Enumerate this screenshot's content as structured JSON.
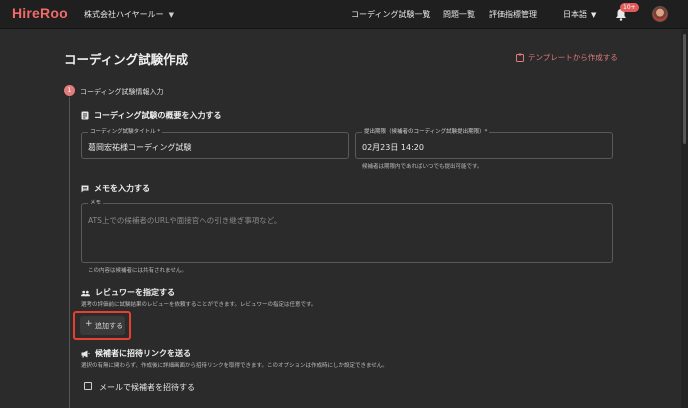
{
  "header": {
    "logo": "HireRoo",
    "company": "株式会社ハイヤールー",
    "nav": [
      "コーディング試験一覧",
      "問題一覧",
      "評価指標管理"
    ],
    "language": "日本語",
    "notification_badge": "10+"
  },
  "page": {
    "title": "コーディング試験作成",
    "template_link": "テンプレートから作成する"
  },
  "step": {
    "number": "1",
    "label": "コーディング試験情報入力"
  },
  "overview": {
    "heading": "コーディング試験の概要を入力する",
    "title_field": {
      "label": "コーディング試験タイトル *",
      "value": "葛岡宏祐様コーディング試験"
    },
    "deadline_field": {
      "label": "提出期限（候補者のコーディング試験提出期限）*",
      "value": "02月23日 14:20",
      "helper": "候補者は期限内であればいつでも提出可能です。"
    }
  },
  "memo": {
    "heading": "メモを入力する",
    "label": "メモ",
    "placeholder": "ATS上での候補者のURLや面接官への引き継ぎ事項など。",
    "helper": "この内容は候補者には共有されません。"
  },
  "reviewer": {
    "heading": "レビュワーを指定する",
    "description": "選考の評価前に試験結果のレビューを依頼することができます。レビュワーの指定は任意です。",
    "add_button": "追加する"
  },
  "invite": {
    "heading": "候補者に招待リンクを送る",
    "description": "選択の有無に関わらず、作成後に詳細画面から招待リンクを取得できます。このオプションは作成時にしか設定できません。",
    "checkbox_label": "メールで候補者を招待する"
  },
  "colors": {
    "accent": "#e37c7c",
    "logo": "#f06a6a",
    "highlight": "#e8402e",
    "background": "#2b2b2b",
    "topbar": "#1f1f1f"
  },
  "icons": {
    "bell": "bell-icon",
    "template": "clipboard-icon",
    "overview": "document-icon",
    "memo": "comment-icon",
    "reviewer": "people-icon",
    "invite": "megaphone-icon"
  }
}
